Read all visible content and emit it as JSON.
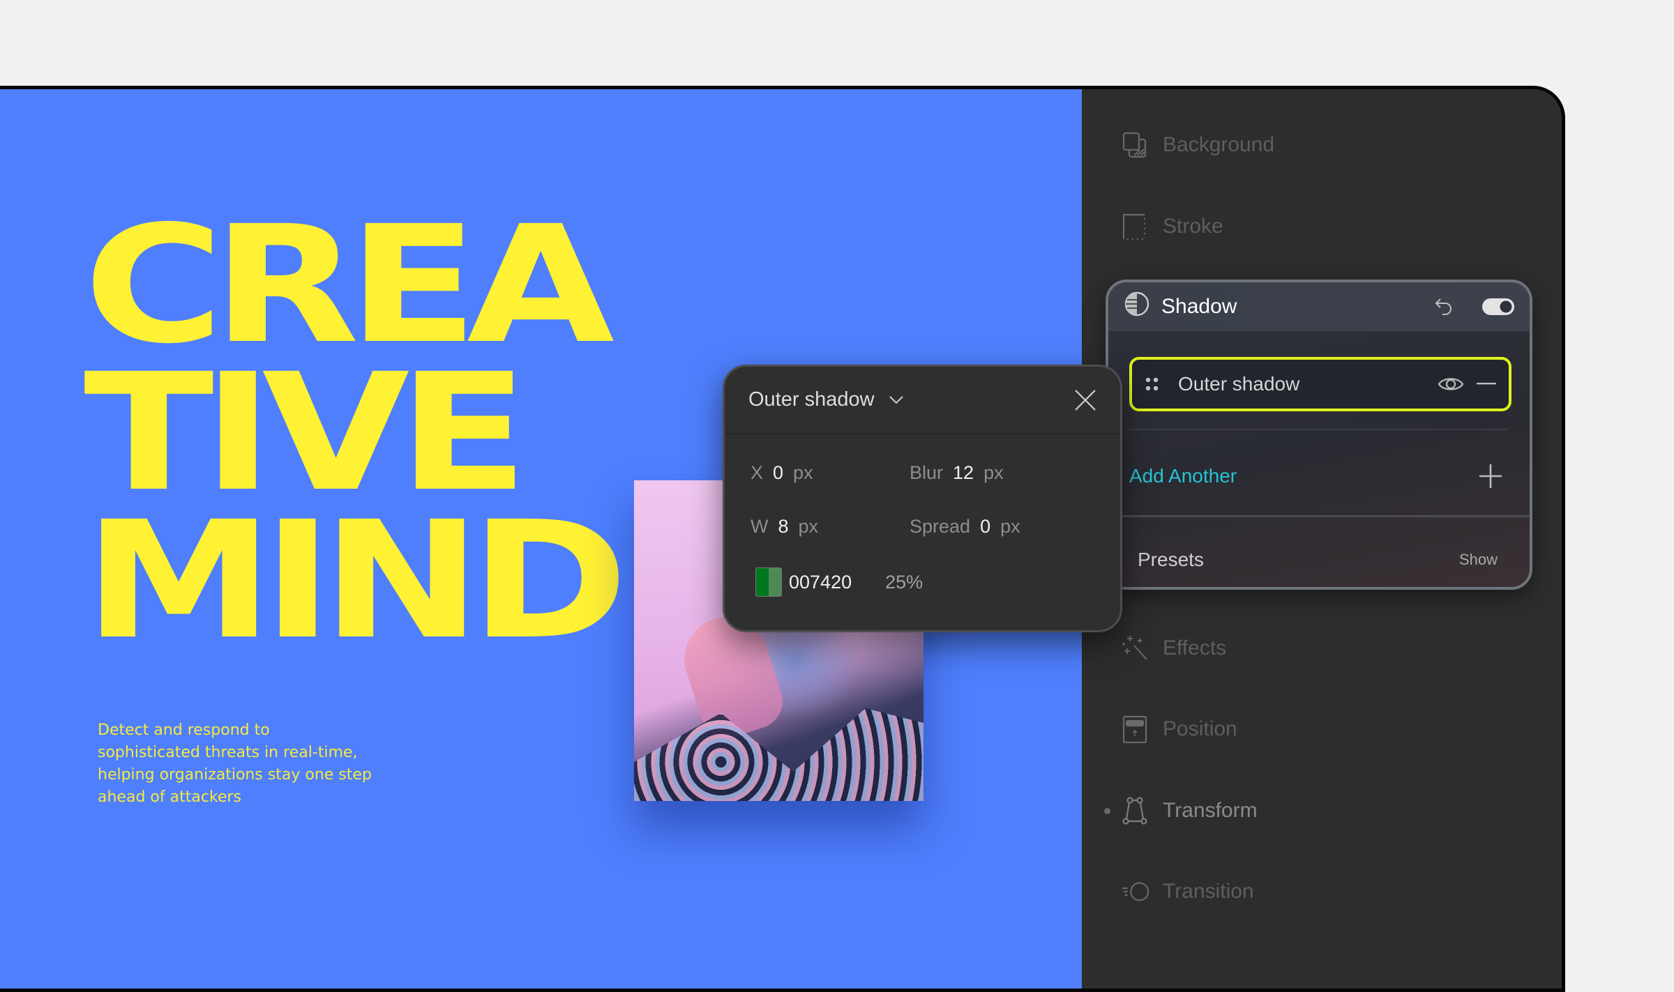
{
  "canvas": {
    "headline_lines": [
      "CREA",
      "TIVE",
      "MIND"
    ],
    "tagline": "Detect and respond to sophisticated threats in real-time, helping organizations stay one step ahead of attackers",
    "colors": {
      "background": "#4f7ffd",
      "headline": "#fff134"
    }
  },
  "panel": {
    "sections": [
      {
        "label": "Background",
        "icon": "background-icon"
      },
      {
        "label": "Stroke",
        "icon": "stroke-icon"
      },
      {
        "label": "Effects",
        "icon": "magic-wand-icon"
      },
      {
        "label": "Position",
        "icon": "position-icon"
      },
      {
        "label": "Transform",
        "icon": "transform-icon",
        "has_indicator": true
      },
      {
        "label": "Transition",
        "icon": "transition-icon"
      }
    ],
    "shadow_card": {
      "title": "Shadow",
      "enabled": true,
      "layer": {
        "label": "Outer shadow",
        "visible": true
      },
      "add_label": "Add Another",
      "presets_label": "Presets",
      "presets_action": "Show",
      "colors": {
        "highlight": "#dff21d",
        "link": "#27c4d3"
      }
    }
  },
  "popup": {
    "type_label": "Outer shadow",
    "fields": {
      "x": {
        "label": "X",
        "value": "0",
        "unit": "px"
      },
      "blur": {
        "label": "Blur",
        "value": "12",
        "unit": "px"
      },
      "w": {
        "label": "W",
        "value": "8",
        "unit": "px"
      },
      "spread": {
        "label": "Spread",
        "value": "0",
        "unit": "px"
      }
    },
    "color_hex": "007420",
    "opacity": "25%"
  }
}
